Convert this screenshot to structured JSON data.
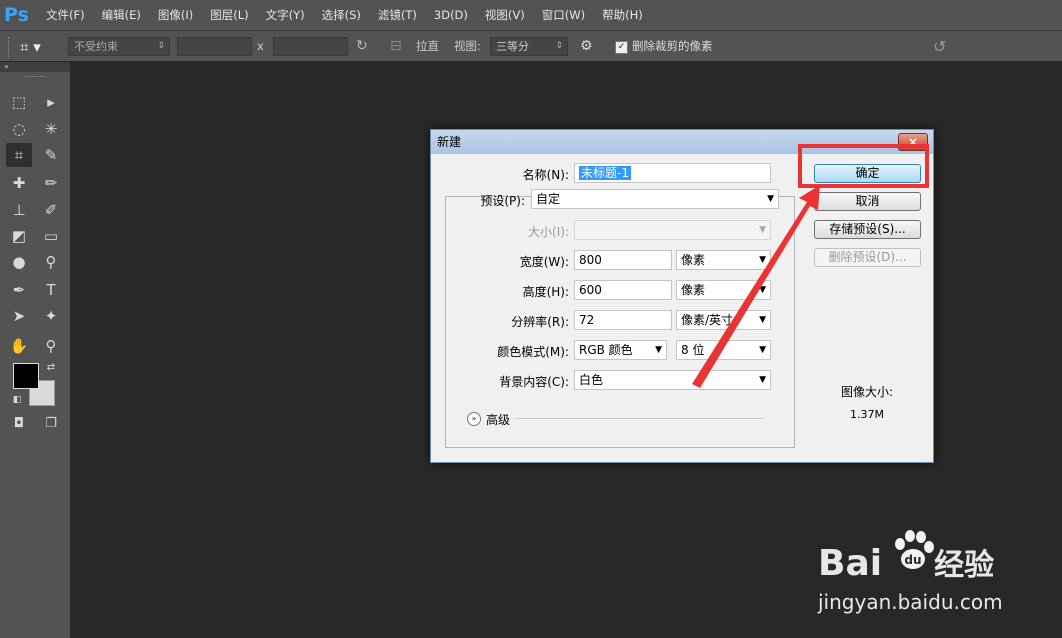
{
  "app": {
    "logo": "Ps"
  },
  "menu": [
    "文件(F)",
    "编辑(E)",
    "图像(I)",
    "图层(L)",
    "文字(Y)",
    "选择(S)",
    "滤镜(T)",
    "3D(D)",
    "视图(V)",
    "窗口(W)",
    "帮助(H)"
  ],
  "options": {
    "ratio_select": "不受约束",
    "x_sep": "x",
    "straighten_label": "拉直",
    "view_label": "视图:",
    "view_select": "三等分",
    "delete_cropped_label": "删除裁剪的像素",
    "delete_cropped_checked": true
  },
  "toolbox": {
    "collapse": "«"
  },
  "dialog": {
    "title": "新建",
    "close": "×",
    "name_label": "名称(N):",
    "name_value": "未标题-1",
    "preset_label": "预设(P):",
    "preset_value": "自定",
    "size_label": "大小(I):",
    "size_value": "",
    "width_label": "宽度(W):",
    "width_value": "800",
    "width_unit": "像素",
    "height_label": "高度(H):",
    "height_value": "600",
    "height_unit": "像素",
    "resolution_label": "分辨率(R):",
    "resolution_value": "72",
    "resolution_unit": "像素/英寸",
    "color_mode_label": "颜色模式(M):",
    "color_mode_value": "RGB 颜色",
    "bit_depth": "8 位",
    "background_label": "背景内容(C):",
    "background_value": "白色",
    "advanced_label": "高级",
    "ok_button": "确定",
    "cancel_button": "取消",
    "save_preset_button": "存储预设(S)...",
    "delete_preset_button": "删除预设(D)...",
    "image_size_label": "图像大小:",
    "image_size_value": "1.37M"
  },
  "annotation": {
    "color": "#ea3333"
  },
  "watermark": {
    "brand": "Bai",
    "brand2": "经验",
    "url": "jingyan.baidu.com"
  }
}
